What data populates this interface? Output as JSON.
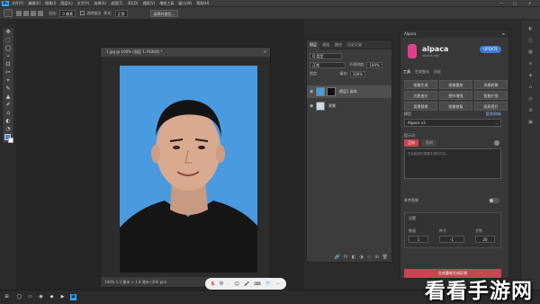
{
  "app": {
    "logo": "Ps",
    "menus": [
      "文件(F)",
      "编辑(E)",
      "图像(I)",
      "图层(L)",
      "文字(Y)",
      "选择(S)",
      "滤镜(T)",
      "3D(D)",
      "视图(V)",
      "增效工具",
      "窗口(W)",
      "帮助(H)"
    ],
    "win_controls": [
      "—",
      "□",
      "✕"
    ]
  },
  "options": {
    "feather_label": "羽化:",
    "feather_value": "0 像素",
    "antialias_label": "消除锯齿",
    "style_label": "样式:",
    "style_value": "正常",
    "select_btn": "选择并遮住..."
  },
  "tools": [
    "✥",
    "⬚",
    "◯",
    "⌁",
    "⊡",
    "✂",
    "⌖",
    "✎",
    "▲",
    "✐",
    "⌂",
    "◐",
    "◔",
    "✒",
    "T",
    "↖",
    "▭",
    "✋",
    "⌕",
    "⋯"
  ],
  "colors": {
    "fg": "#4b7fd3",
    "bg": "#ffffff",
    "accent": "#3d7be0",
    "photo_bg": "#4a9ae0"
  },
  "document": {
    "title": "1.jpg @ 100% (图层 1, RGB/8) *",
    "status": "100%  1.2 厘米 × 1.8 厘米 (300 ppi)"
  },
  "layers": {
    "tabs": [
      "图层",
      "通道",
      "路径",
      "历史记录"
    ],
    "filter_label": "Q 类型",
    "blend": "正常",
    "opacity_label": "不透明度:",
    "opacity": "100%",
    "lock_label": "锁定:",
    "fill_label": "填充:",
    "fill": "100%",
    "items": [
      {
        "name": "图层1 副本",
        "thumb_color": "#4a9ae0"
      },
      {
        "name": "背景",
        "thumb_color": "#cfd8e0"
      }
    ],
    "bottom_icons": [
      "🔗",
      "fx",
      "◧",
      "◑",
      "▭",
      "⊞",
      "🗑"
    ]
  },
  "alpaca": {
    "header": "Alpaca",
    "close": "≡",
    "name": "alpaca",
    "sub": "alpaca.app",
    "pill": "UPDATE",
    "tabs": [
      "工具",
      "生成变化",
      "历史"
    ],
    "grid": [
      "图像生成",
      "图像重绘",
      "风格转换",
      "光影变化",
      "细节增强",
      "智能扩图",
      "背景替换",
      "图像修复",
      "画质提升"
    ],
    "model_label": "模型",
    "model_link": "管理/刷新",
    "model_value": "Alpaca v3",
    "prompt_label": "提示词",
    "prompt_tabs": [
      "正向",
      "负向"
    ],
    "prompt_placeholder": "在此描述你想要生成的内容...",
    "ref_label": "参考图像",
    "settings_label": "设置",
    "fields": [
      {
        "label": "数量",
        "value": "1"
      },
      {
        "label": "种子",
        "value": "-1"
      },
      {
        "label": "步数",
        "value": "20"
      }
    ],
    "generate": "生成重新生成区域"
  },
  "right_icons": [
    "◐",
    "◫",
    "▦",
    "≡",
    "◈",
    "⌂",
    "◎",
    "⊕",
    "▣"
  ],
  "taskbar": {
    "icons": [
      "⊞",
      "◯",
      "▭",
      "◉",
      "◆",
      "▶",
      "▣"
    ]
  },
  "ime": {
    "items": [
      "S",
      "中",
      "·",
      "☺",
      "🎤",
      "⌨",
      "👕",
      "⋯"
    ]
  },
  "watermark": "看看手游网"
}
